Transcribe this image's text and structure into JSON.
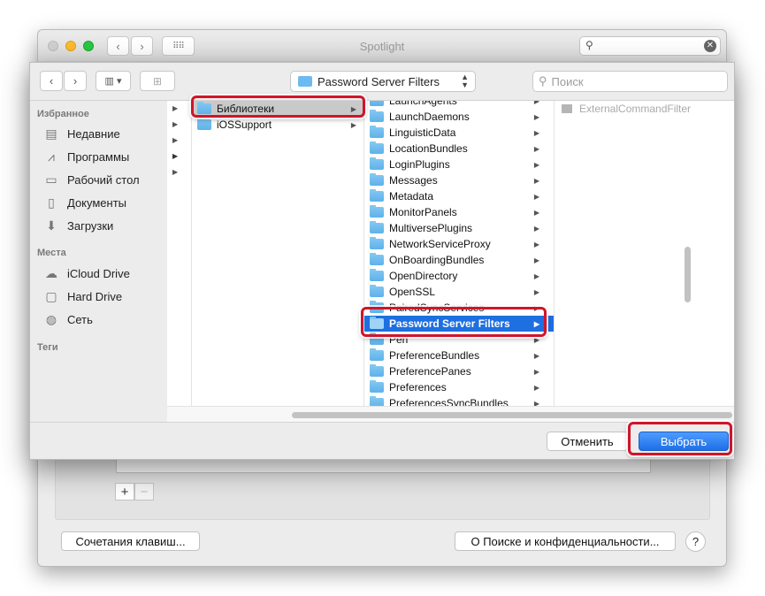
{
  "prefs_window": {
    "title": "Spotlight",
    "back_icon": "chevron-left",
    "forward_icon": "chevron-right",
    "grid_icon": "grid",
    "search": {
      "value": "",
      "placeholder": ""
    },
    "add_symbol": "+",
    "remove_symbol": "−",
    "shortcuts_button": "Сочетания клавиш...",
    "privacy_button": "О Поиске и конфиденциальности...",
    "help_button": "?"
  },
  "dialog": {
    "path_popup": "Password Server Filters",
    "search_placeholder": "Поиск",
    "sidebar": {
      "favorites_header": "Избранное",
      "favorites": [
        {
          "label": "Недавние",
          "icon": "clock-icon"
        },
        {
          "label": "Программы",
          "icon": "apps-icon"
        },
        {
          "label": "Рабочий стол",
          "icon": "desktop-icon"
        },
        {
          "label": "Документы",
          "icon": "document-icon"
        },
        {
          "label": "Загрузки",
          "icon": "download-icon"
        }
      ],
      "places_header": "Места",
      "places": [
        {
          "label": "iCloud Drive",
          "icon": "cloud-icon"
        },
        {
          "label": "Hard Drive",
          "icon": "disk-icon"
        },
        {
          "label": "Сеть",
          "icon": "network-icon"
        }
      ],
      "tags_header": "Теги"
    },
    "column2": [
      {
        "label": "Библиотеки",
        "selected": true
      },
      {
        "label": "iOSSupport",
        "selected": false
      }
    ],
    "column3": [
      {
        "label": "LaunchAgents"
      },
      {
        "label": "LaunchDaemons"
      },
      {
        "label": "LinguisticData"
      },
      {
        "label": "LocationBundles"
      },
      {
        "label": "LoginPlugins"
      },
      {
        "label": "Messages"
      },
      {
        "label": "Metadata"
      },
      {
        "label": "MonitorPanels"
      },
      {
        "label": "MultiversePlugins"
      },
      {
        "label": "NetworkServiceProxy"
      },
      {
        "label": "OnBoardingBundles"
      },
      {
        "label": "OpenDirectory"
      },
      {
        "label": "OpenSSL"
      },
      {
        "label": "PairedSyncServices"
      },
      {
        "label": "Password Server Filters",
        "selected": true
      },
      {
        "label": "Perl"
      },
      {
        "label": "PreferenceBundles"
      },
      {
        "label": "PreferencePanes"
      },
      {
        "label": "Preferences"
      },
      {
        "label": "PreferencesSyncBundles"
      }
    ],
    "column4": [
      {
        "label": "ExternalCommandFilter"
      }
    ],
    "cancel_button": "Отменить",
    "choose_button": "Выбрать"
  },
  "colors": {
    "selection": "#1e6fe0",
    "highlight_ring": "#d0152a",
    "folder": "#6cbaf0",
    "primary_button": "#2f7ff0"
  }
}
